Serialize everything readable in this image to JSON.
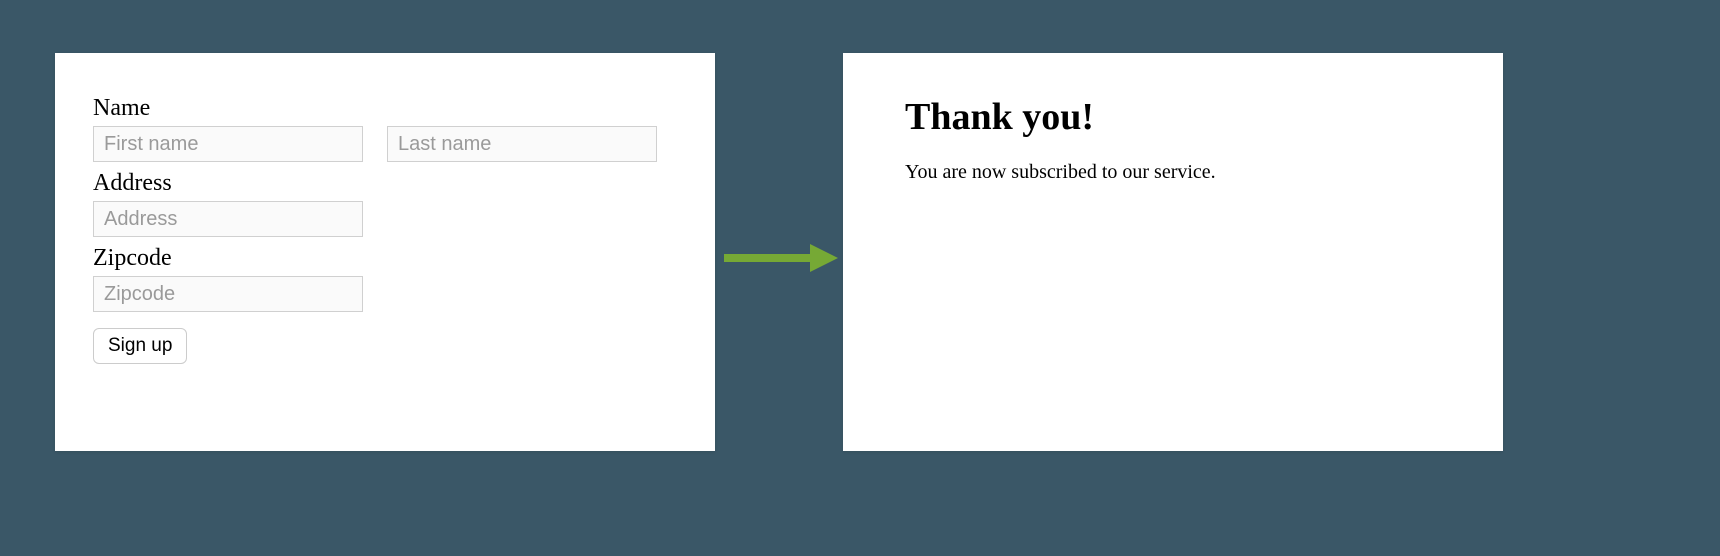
{
  "form": {
    "name_label": "Name",
    "first_name_placeholder": "First name",
    "last_name_placeholder": "Last name",
    "address_label": "Address",
    "address_placeholder": "Address",
    "zipcode_label": "Zipcode",
    "zipcode_placeholder": "Zipcode",
    "signup_button": "Sign up"
  },
  "confirmation": {
    "title": "Thank you!",
    "body": "You are now subscribed to our service."
  },
  "colors": {
    "background": "#3a5767",
    "arrow": "#76a935"
  }
}
